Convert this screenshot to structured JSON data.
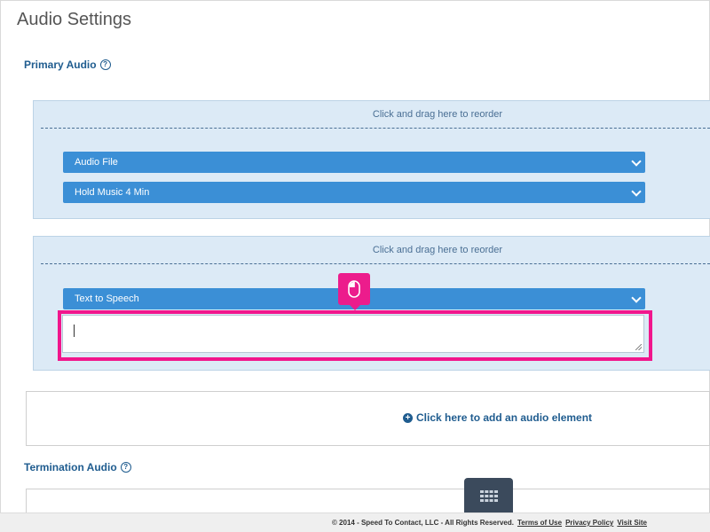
{
  "page": {
    "title": "Audio Settings"
  },
  "primary_audio": {
    "label": "Primary Audio",
    "help_glyph": "?",
    "blocks": [
      {
        "drag_text": "Click and drag here to reorder",
        "selects": [
          "Audio File",
          "Hold Music 4 Min"
        ]
      },
      {
        "drag_text": "Click and drag here to reorder",
        "selects": [
          "Text to Speech"
        ],
        "textarea_value": ""
      }
    ],
    "add_element": {
      "icon_glyph": "+",
      "label": "Click here to add an audio element"
    }
  },
  "termination_audio": {
    "label": "Termination Audio",
    "help_glyph": "?"
  },
  "footer": {
    "copyright": "© 2014 - Speed To Contact, LLC - All Rights Reserved.",
    "links": [
      "Terms of Use",
      "Privacy Policy",
      "Visit Site"
    ]
  },
  "colors": {
    "accent": "#3b8fd6",
    "highlight": "#f1168c",
    "block_bg": "#dceaf6",
    "link": "#1f5c8f"
  }
}
